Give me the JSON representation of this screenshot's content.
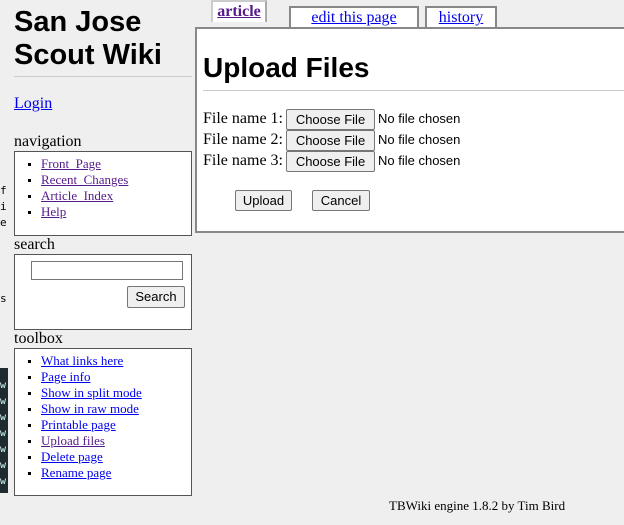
{
  "site": {
    "title": "San Jose\nScout Wiki",
    "login": "Login"
  },
  "navigation": {
    "title": "navigation",
    "items": [
      "Front_Page",
      "Recent_Changes",
      "Article_Index",
      "Help"
    ]
  },
  "search": {
    "title": "search",
    "button": "Search",
    "value": ""
  },
  "toolbox": {
    "title": "toolbox",
    "items": [
      "What links here",
      "Page info",
      "Show in split mode",
      "Show in raw mode",
      "Printable page",
      "Upload files",
      "Delete page",
      "Rename page"
    ]
  },
  "tabs": {
    "article": "article",
    "edit": "edit this page",
    "history": "history"
  },
  "page": {
    "heading": "Upload Files",
    "files": [
      {
        "label": "File name 1:",
        "button": "Choose File",
        "status": "No file chosen"
      },
      {
        "label": "File name 2:",
        "button": "Choose File",
        "status": "No file chosen"
      },
      {
        "label": "File name 3:",
        "button": "Choose File",
        "status": "No file chosen"
      }
    ],
    "upload_button": "Upload",
    "cancel_button": "Cancel"
  },
  "footer": "TBWiki engine 1.8.2 by Tim Bird",
  "colors": {
    "link": "#0000ee",
    "visited": "#551a8b",
    "background": "#efefef"
  }
}
